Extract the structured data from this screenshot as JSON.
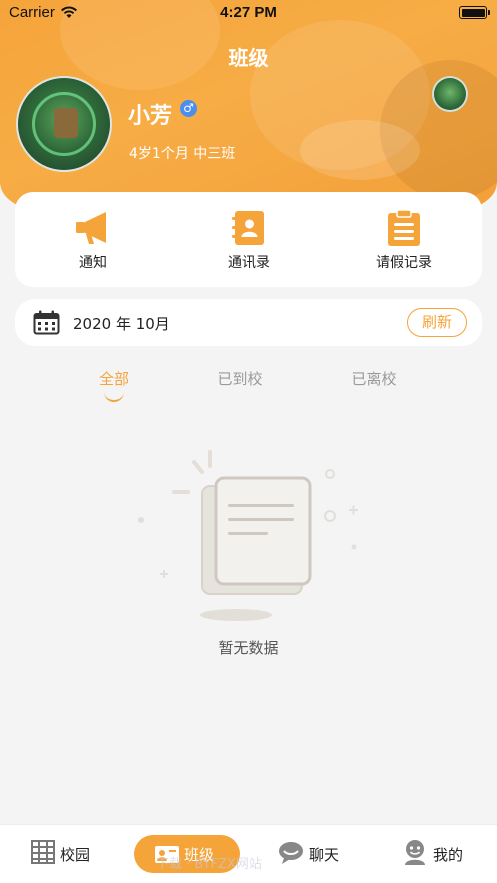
{
  "status_bar": {
    "carrier": "Carrier",
    "time": "4:27 PM"
  },
  "header": {
    "title": "班级",
    "student_name": "小芳",
    "gender_symbol": "♂",
    "student_info": "4岁1个月  中三班"
  },
  "actions": [
    {
      "label": "通知",
      "icon": "megaphone-icon"
    },
    {
      "label": "通讯录",
      "icon": "contacts-book-icon"
    },
    {
      "label": "请假记录",
      "icon": "clipboard-icon"
    }
  ],
  "date_bar": {
    "date": "2020 年 10月",
    "refresh_label": "刷新"
  },
  "tabs": [
    {
      "label": "全部",
      "active": true
    },
    {
      "label": "已到校",
      "active": false
    },
    {
      "label": "已离校",
      "active": false
    }
  ],
  "empty_state": {
    "text": "暂无数据"
  },
  "bottom_nav": [
    {
      "label": "校园",
      "icon": "building-icon",
      "active": false
    },
    {
      "label": "班级",
      "icon": "class-icon",
      "active": true
    },
    {
      "label": "聊天",
      "icon": "chat-icon",
      "active": false
    },
    {
      "label": "我的",
      "icon": "profile-icon",
      "active": false
    }
  ],
  "watermark": "下载 · BYFZX网站",
  "colors": {
    "accent": "#f5a43a",
    "gender": "#4b8ef0",
    "background": "#f4f4f4"
  }
}
